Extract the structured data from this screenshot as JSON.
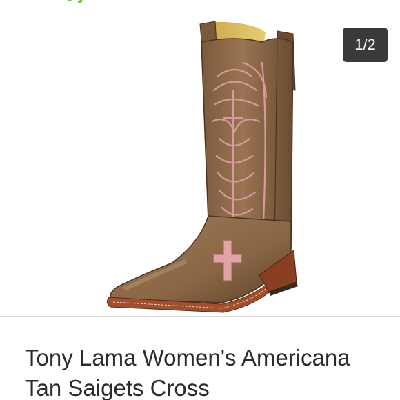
{
  "carousel": {
    "page_indicator": "1/2"
  },
  "listing": {
    "title": "Tony Lama Women's Americana Tan Saigets Cross"
  },
  "icons": {
    "brand": "brand-logo-icon"
  },
  "colors": {
    "brand_green": "#7ac142",
    "indicator_bg": "#3a3a3a",
    "title_text": "#2b2b2b",
    "divider": "#d9d9d9"
  }
}
